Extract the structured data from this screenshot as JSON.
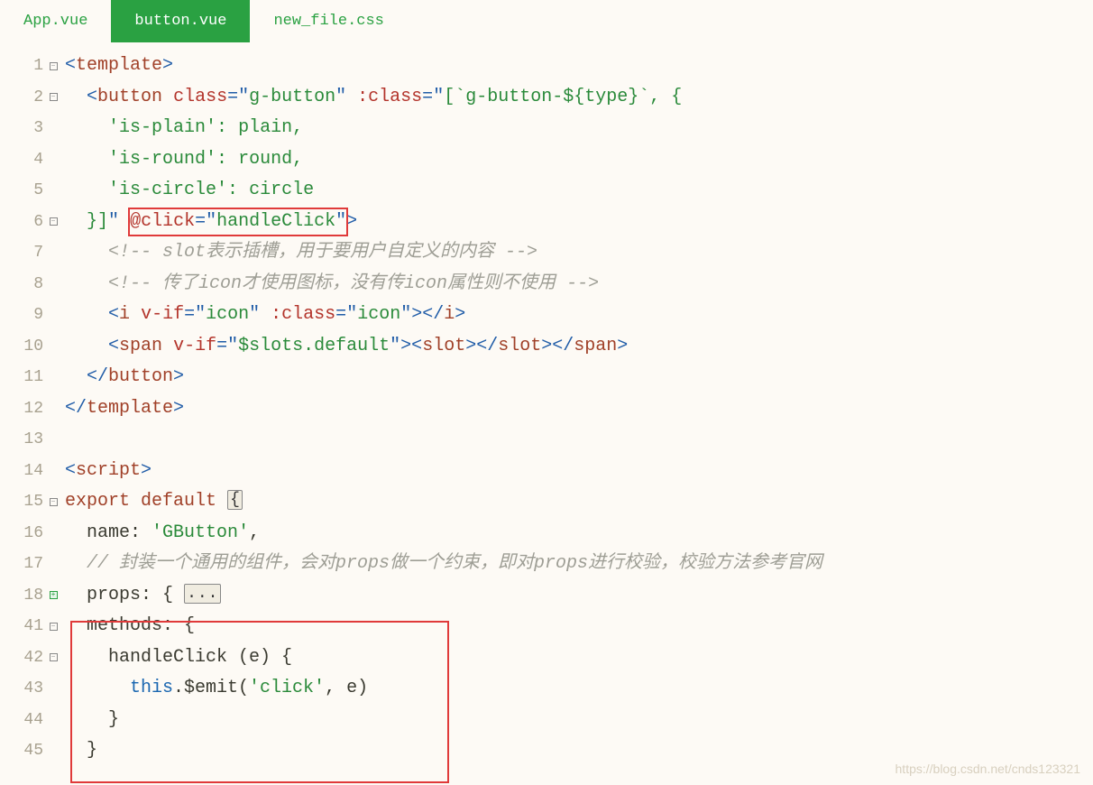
{
  "tabs": [
    {
      "label": "App.vue",
      "active": false
    },
    {
      "label": "button.vue",
      "active": true
    },
    {
      "label": "new_file.css",
      "active": false
    }
  ],
  "lines": {
    "l1": {
      "num": "1"
    },
    "l2": {
      "num": "2"
    },
    "l3": {
      "num": "3"
    },
    "l4": {
      "num": "4"
    },
    "l5": {
      "num": "5"
    },
    "l6": {
      "num": "6"
    },
    "l7": {
      "num": "7"
    },
    "l8": {
      "num": "8"
    },
    "l9": {
      "num": "9"
    },
    "l10": {
      "num": "10"
    },
    "l11": {
      "num": "11"
    },
    "l12": {
      "num": "12"
    },
    "l13": {
      "num": "13"
    },
    "l14": {
      "num": "14"
    },
    "l15": {
      "num": "15"
    },
    "l16": {
      "num": "16"
    },
    "l17": {
      "num": "17"
    },
    "l18": {
      "num": "18"
    },
    "l41": {
      "num": "41"
    },
    "l42": {
      "num": "42"
    },
    "l43": {
      "num": "43"
    },
    "l44": {
      "num": "44"
    },
    "l45": {
      "num": "45"
    }
  },
  "tok": {
    "lt": "<",
    "gt": ">",
    "ltc": "</",
    "template": "template",
    "button": "button",
    "script": "script",
    "span": "span",
    "slot": "slot",
    "i_tag": "i",
    "class_attr": "class",
    "vclass_attr": ":class",
    "vif_attr": "v-if",
    "eq": "=",
    "q": "\"",
    "g_button": "g-button",
    "class_expr_open": "[`g-button-${type}`, {",
    "is_plain": "'is-plain'",
    "is_round": "'is-round'",
    "is_circle": "'is-circle'",
    "colon": ": ",
    "plain_id": "plain",
    "round_id": "round",
    "circle_id": "circle",
    "comma": ",",
    "close_arr": "}]",
    "at_click": "@click",
    "handleClick_str": "handleClick",
    "comment1": " slot表示插槽，用于要用户自定义的内容 ",
    "comment2": " 传了icon才使用图标，没有传icon属性则不使用 ",
    "cm_open": "<!--",
    "cm_close": "-->",
    "icon_str": "icon",
    "slots_default": "$slots.default",
    "export": "export",
    "default": "default",
    "brace_open": "{",
    "brace_close": "}",
    "name_key": "name",
    "gbutton_val": "'GButton'",
    "props_comment": "// 封装一个通用的组件，会对props做一个约束，即对props进行校验，校验方法参考官网",
    "props_key": "props",
    "props_open": ": {",
    "dots": "...",
    "methods_key": "methods",
    "handleClick_fn": "handleClick",
    "e_param": " (e) {",
    "this_kw": "this",
    "emit": ".$emit(",
    "click_str": "'click'",
    "emit_rest": ", e)",
    "indent2": "  ",
    "indent4": "    ",
    "indent6": "      ",
    "indent8": "        ",
    "space": " "
  },
  "watermark": "https://blog.csdn.net/cnds123321"
}
